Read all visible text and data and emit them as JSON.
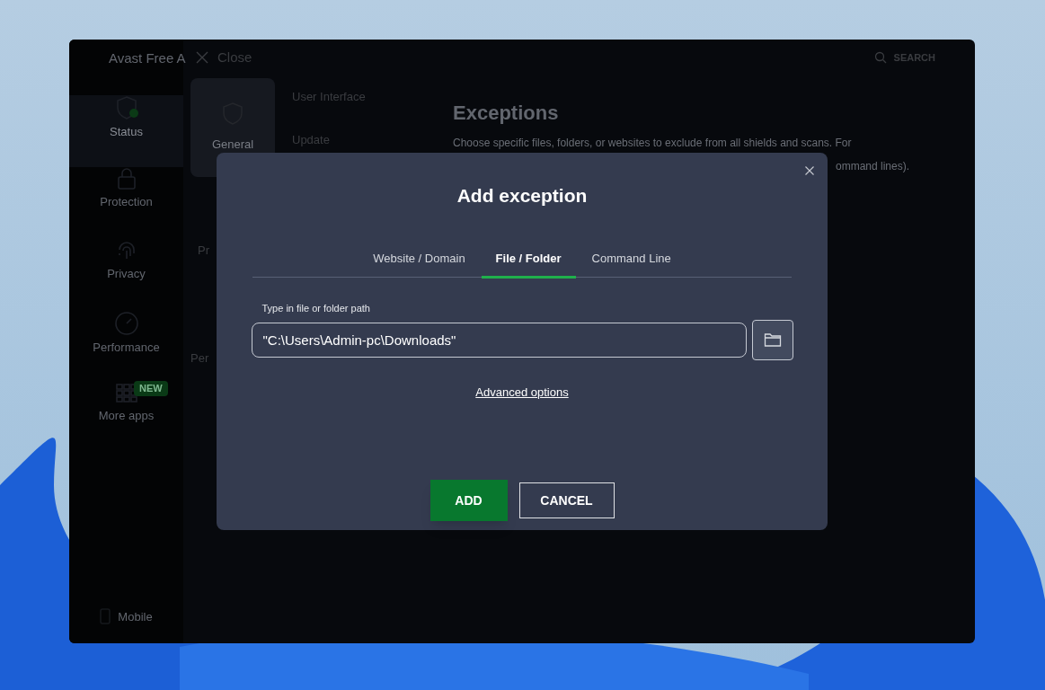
{
  "window": {
    "app_title": "Avast Free A",
    "close_label": "Close",
    "search_label": "SEARCH"
  },
  "sidebar": {
    "items": [
      {
        "label": "Status",
        "selected": true
      },
      {
        "label": "Protection",
        "selected": false
      },
      {
        "label": "Privacy",
        "selected": false
      },
      {
        "label": "Performance",
        "selected": false
      },
      {
        "label": "More apps",
        "selected": false,
        "badge": "NEW"
      }
    ],
    "mobile_label": "Mobile"
  },
  "categories": [
    {
      "label": "General",
      "selected": true
    }
  ],
  "submenu": [
    "User Interface",
    "Update"
  ],
  "covered_items": [
    "Pr",
    "Per"
  ],
  "content": {
    "title": "Exceptions",
    "description": "Choose specific files, folders, or websites to exclude from all shields and scans. For",
    "description_tail": "ommand lines)."
  },
  "dialog": {
    "title": "Add exception",
    "tabs": [
      {
        "label": "Website / Domain",
        "selected": false
      },
      {
        "label": "File / Folder",
        "selected": true
      },
      {
        "label": "Command Line",
        "selected": false
      }
    ],
    "field": {
      "label": "Type in file or folder path",
      "value": "\"C:\\Users\\Admin-pc\\Downloads\""
    },
    "link": "Advanced options",
    "buttons": [
      {
        "label": "ADD",
        "kind": "primary"
      },
      {
        "label": "CANCEL",
        "kind": "secondary"
      }
    ]
  }
}
